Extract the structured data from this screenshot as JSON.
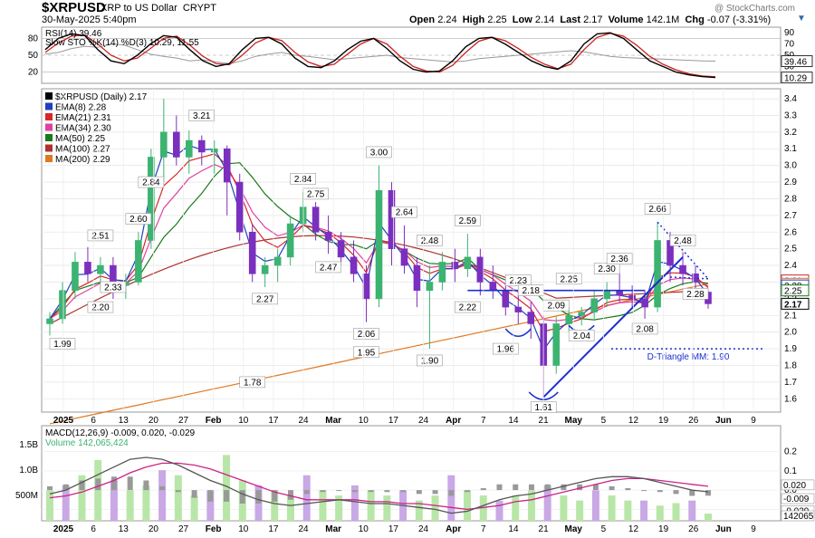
{
  "header": {
    "symbol": "$XRPUSD",
    "name": "XRP to US Dollar",
    "exchange": "CRYPT",
    "date": "30-May-2025 5:40pm",
    "watermark": "@ StockCharts.com",
    "ohlc": {
      "open_label": "Open",
      "open": "2.24",
      "high_label": "High",
      "high": "2.25",
      "low_label": "Low",
      "low": "2.14",
      "last_label": "Last",
      "last": "2.17",
      "volume_label": "Volume",
      "volume": "142.1M",
      "chg_label": "Chg",
      "chg": "-0.07 (-3.31%)"
    },
    "caret_icon": "caret-down-icon"
  },
  "colors": {
    "up": "#3cb371",
    "down": "#7b2fbf",
    "ema8": "#1f3fbf",
    "ema21": "#d62728",
    "ema34": "#e040a0",
    "ma50": "#1a7a1a",
    "ma100": "#b03030",
    "ma200": "#e07820",
    "trend": "#1a2fd0",
    "rsi": "#000000",
    "sto": "#cc2222",
    "macd": "#cc2288",
    "signal": "#555555",
    "hist": "#808080"
  },
  "chart_data": [
    {
      "type": "line",
      "panel": "RSI / Slow Stochastic",
      "legend": [
        "RSI(14) 39.46",
        "Slow STO %K(14) %D(3) 10.29, 11.55"
      ],
      "ylim": [
        0,
        100
      ],
      "left_ticks": [
        "80",
        "50",
        "20"
      ],
      "right_ticks": [
        "90",
        "70",
        "50",
        "30",
        "10"
      ],
      "last_value_labels": [
        "39.46",
        "10.29"
      ],
      "grid": true,
      "series": [
        {
          "name": "RSI(14)",
          "values": [
            52,
            55,
            62,
            66,
            64,
            70,
            68,
            60,
            52,
            48,
            45,
            40,
            42,
            38,
            35,
            40,
            48,
            52,
            55,
            50,
            48,
            45,
            42,
            44,
            46,
            48,
            50,
            46,
            44,
            42,
            40,
            38,
            40,
            44,
            46,
            48,
            50,
            52,
            54,
            56,
            58,
            56,
            52,
            48,
            46,
            45,
            44,
            43,
            42,
            41,
            40,
            39.46
          ]
        },
        {
          "name": "Slow STO %K",
          "values": [
            60,
            80,
            88,
            85,
            60,
            40,
            35,
            50,
            70,
            85,
            82,
            60,
            40,
            30,
            35,
            60,
            80,
            82,
            70,
            45,
            30,
            28,
            40,
            60,
            75,
            80,
            62,
            40,
            25,
            20,
            22,
            40,
            65,
            80,
            82,
            70,
            55,
            40,
            30,
            25,
            40,
            70,
            88,
            90,
            80,
            60,
            40,
            30,
            20,
            15,
            12,
            10.29
          ]
        },
        {
          "name": "Slow STO %D",
          "values": [
            55,
            72,
            84,
            86,
            70,
            50,
            40,
            45,
            62,
            80,
            84,
            68,
            48,
            35,
            33,
            50,
            72,
            82,
            76,
            55,
            38,
            30,
            34,
            52,
            70,
            80,
            70,
            48,
            30,
            22,
            20,
            32,
            55,
            75,
            82,
            76,
            62,
            46,
            34,
            26,
            34,
            60,
            82,
            89,
            84,
            68,
            48,
            34,
            24,
            17,
            13,
            11.55
          ]
        }
      ]
    },
    {
      "type": "bar",
      "panel": "Price (candlestick)",
      "legend": [
        "$XRPUSD (Daily) 2.17",
        "EMA(8) 2.28",
        "EMA(21) 2.31",
        "EMA(34) 2.30",
        "MA(50) 2.25",
        "MA(100) 2.27",
        "MA(200) 2.29"
      ],
      "ylim": [
        1.52,
        3.46
      ],
      "right_ticks": [
        "3.4",
        "3.3",
        "3.2",
        "3.1",
        "3.0",
        "2.9",
        "2.8",
        "2.7",
        "2.6",
        "2.5",
        "2.4",
        "2.3",
        "2.2",
        "2.1",
        "2.0",
        "1.9",
        "1.8",
        "1.7",
        "1.6"
      ],
      "last_value_labels": [
        "2.31",
        "2.29",
        "2.28",
        "2.25",
        "2.17"
      ],
      "x_ticks": [
        "2025",
        "6",
        "13",
        "20",
        "27",
        "Feb",
        "10",
        "17",
        "24",
        "Mar",
        "10",
        "17",
        "24",
        "Apr",
        "7",
        "14",
        "21",
        "May",
        "5",
        "12",
        "19",
        "26",
        "Jun",
        "9"
      ],
      "annotations": [
        "3.21",
        "2.84",
        "2.60",
        "2.51",
        "2.33",
        "2.20",
        "1.99",
        "2.84",
        "2.75",
        "2.47",
        "2.27",
        "1.78",
        "3.00",
        "2.64",
        "2.06",
        "1.95",
        "2.48",
        "2.59",
        "2.22",
        "1.90",
        "2.23",
        "2.18",
        "2.25",
        "2.09",
        "1.96",
        "1.61",
        "2.04",
        "2.30",
        "2.36",
        "2.08",
        "2.66",
        "2.48",
        "2.28",
        "D-Triangle MM: 1.90"
      ],
      "candles": [
        [
          2.05,
          2.12,
          1.98,
          2.08
        ],
        [
          2.08,
          2.3,
          2.05,
          2.25
        ],
        [
          2.25,
          2.48,
          2.2,
          2.42
        ],
        [
          2.42,
          2.51,
          2.3,
          2.35
        ],
        [
          2.35,
          2.45,
          2.25,
          2.4
        ],
        [
          2.4,
          2.45,
          2.2,
          2.28
        ],
        [
          2.28,
          2.35,
          2.2,
          2.3
        ],
        [
          2.3,
          2.6,
          2.28,
          2.55
        ],
        [
          2.55,
          3.1,
          2.5,
          3.05
        ],
        [
          3.05,
          3.4,
          2.9,
          3.2
        ],
        [
          3.2,
          3.3,
          3.0,
          3.05
        ],
        [
          3.05,
          3.21,
          2.95,
          3.15
        ],
        [
          3.15,
          3.18,
          3.0,
          3.08
        ],
        [
          3.08,
          3.15,
          2.95,
          3.1
        ],
        [
          3.1,
          3.12,
          2.7,
          2.9
        ],
        [
          2.9,
          2.95,
          2.55,
          2.6
        ],
        [
          2.6,
          2.65,
          2.3,
          2.35
        ],
        [
          2.35,
          2.45,
          2.27,
          2.4
        ],
        [
          2.4,
          2.5,
          2.3,
          2.45
        ],
        [
          2.45,
          2.7,
          2.4,
          2.65
        ],
        [
          2.65,
          2.84,
          2.6,
          2.75
        ],
        [
          2.75,
          2.78,
          2.55,
          2.6
        ],
        [
          2.6,
          2.7,
          2.47,
          2.55
        ],
        [
          2.55,
          2.6,
          2.4,
          2.45
        ],
        [
          2.45,
          2.55,
          2.3,
          2.35
        ],
        [
          2.35,
          2.4,
          2.06,
          2.2
        ],
        [
          2.2,
          3.0,
          2.15,
          2.85
        ],
        [
          2.85,
          2.9,
          2.4,
          2.5
        ],
        [
          2.5,
          2.64,
          2.35,
          2.4
        ],
        [
          2.4,
          2.45,
          2.15,
          2.25
        ],
        [
          2.25,
          2.4,
          1.9,
          2.3
        ],
        [
          2.3,
          2.48,
          2.25,
          2.42
        ],
        [
          2.42,
          2.5,
          2.3,
          2.38
        ],
        [
          2.38,
          2.59,
          2.33,
          2.45
        ],
        [
          2.45,
          2.5,
          2.22,
          2.3
        ],
        [
          2.3,
          2.4,
          2.2,
          2.25
        ],
        [
          2.25,
          2.3,
          2.1,
          2.15
        ],
        [
          2.15,
          2.23,
          2.05,
          2.12
        ],
        [
          2.12,
          2.18,
          1.96,
          2.05
        ],
        [
          2.05,
          2.1,
          1.61,
          1.8
        ],
        [
          1.8,
          2.09,
          1.75,
          2.05
        ],
        [
          2.05,
          2.15,
          2.0,
          2.1
        ],
        [
          2.1,
          2.15,
          2.04,
          2.12
        ],
        [
          2.12,
          2.25,
          2.08,
          2.2
        ],
        [
          2.2,
          2.3,
          2.15,
          2.25
        ],
        [
          2.25,
          2.36,
          2.18,
          2.22
        ],
        [
          2.22,
          2.28,
          2.15,
          2.2
        ],
        [
          2.2,
          2.25,
          2.08,
          2.15
        ],
        [
          2.15,
          2.66,
          2.12,
          2.55
        ],
        [
          2.55,
          2.6,
          2.3,
          2.4
        ],
        [
          2.4,
          2.48,
          2.28,
          2.35
        ],
        [
          2.35,
          2.4,
          2.25,
          2.3
        ],
        [
          2.24,
          2.25,
          2.14,
          2.17
        ]
      ]
    },
    {
      "type": "line",
      "panel": "MACD / Volume",
      "legend": [
        "MACD(12,26,9) -0.009, 0.020, -0.029",
        "Volume 142,065,424"
      ],
      "right_ticks": [
        "0.2",
        "0.1",
        "0.0",
        "-0.1"
      ],
      "left_ticks": [
        "1.5B",
        "1.0B",
        "500M"
      ],
      "last_value_labels": [
        "0.020",
        "-0.009",
        "-0.029",
        "142065"
      ],
      "x_ticks": [
        "2025",
        "6",
        "13",
        "20",
        "27",
        "Feb",
        "10",
        "17",
        "24",
        "Mar",
        "10",
        "17",
        "24",
        "Apr",
        "7",
        "14",
        "21",
        "May",
        "5",
        "12",
        "19",
        "26",
        "Jun",
        "9"
      ],
      "series": [
        {
          "name": "MACD",
          "values": [
            -0.02,
            0.0,
            0.04,
            0.08,
            0.12,
            0.16,
            0.17,
            0.16,
            0.13,
            0.09,
            0.05,
            0.02,
            -0.02,
            -0.05,
            -0.07,
            -0.08,
            -0.07,
            -0.06,
            -0.05,
            -0.06,
            -0.07,
            -0.07,
            -0.08,
            -0.09,
            -0.1,
            -0.12,
            -0.11,
            -0.08,
            -0.05,
            -0.03,
            -0.02,
            0.0,
            0.02,
            0.04,
            0.06,
            0.07,
            0.07,
            0.06,
            0.04,
            0.02,
            0.0,
            -0.009
          ]
        },
        {
          "name": "Signal",
          "values": [
            -0.04,
            -0.03,
            -0.01,
            0.02,
            0.05,
            0.09,
            0.12,
            0.14,
            0.14,
            0.13,
            0.11,
            0.08,
            0.05,
            0.02,
            -0.01,
            -0.03,
            -0.05,
            -0.05,
            -0.05,
            -0.05,
            -0.06,
            -0.06,
            -0.07,
            -0.07,
            -0.08,
            -0.09,
            -0.1,
            -0.09,
            -0.08,
            -0.06,
            -0.05,
            -0.03,
            -0.01,
            0.01,
            0.03,
            0.05,
            0.06,
            0.06,
            0.05,
            0.04,
            0.03,
            0.02
          ]
        },
        {
          "name": "Volume",
          "values": [
            0.6,
            0.7,
            0.9,
            1.2,
            0.8,
            0.6,
            0.7,
            1.0,
            0.9,
            0.5,
            0.6,
            1.3,
            0.8,
            0.7,
            0.6,
            0.5,
            0.9,
            0.6,
            0.5,
            0.7,
            0.6,
            0.5,
            0.6,
            0.4,
            0.5,
            0.9,
            0.6,
            0.5,
            0.4,
            0.5,
            0.6,
            0.7,
            0.5,
            0.4,
            0.6,
            0.5,
            0.4,
            0.4,
            0.3,
            0.35,
            0.4,
            0.142
          ]
        }
      ]
    }
  ]
}
